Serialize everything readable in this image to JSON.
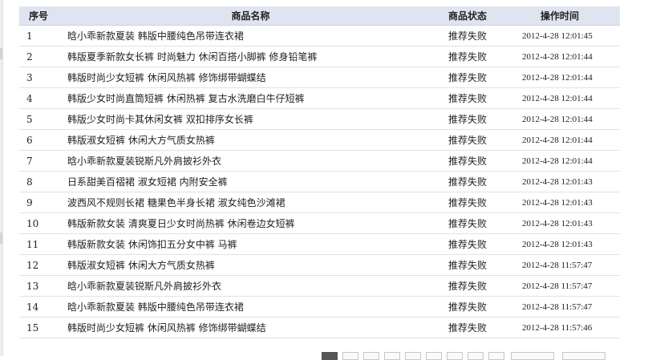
{
  "table": {
    "headers": {
      "index": "序号",
      "name": "商品名称",
      "status": "商品状态",
      "time": "操作时间"
    },
    "rows": [
      {
        "index": "1",
        "name": "晗小乖新款夏装 韩版中腰纯色吊带连衣裙",
        "status": "推荐失败",
        "time": "2012-4-28 12:01:45"
      },
      {
        "index": "2",
        "name": "韩版夏季新款女长裤 时尚魅力 休闲百搭小脚裤 修身铅笔裤",
        "status": "推荐失败",
        "time": "2012-4-28 12:01:44"
      },
      {
        "index": "3",
        "name": "韩版时尚少女短裤 休闲风热裤 修饰绑带蝴蝶结",
        "status": "推荐失败",
        "time": "2012-4-28 12:01:44"
      },
      {
        "index": "4",
        "name": "韩版少女时尚直筒短裤 休闲热裤 复古水洗磨白牛仔短裤",
        "status": "推荐失败",
        "time": "2012-4-28 12:01:44"
      },
      {
        "index": "5",
        "name": "韩版少女时尚卡其休闲女裤 双扣排序女长裤",
        "status": "推荐失败",
        "time": "2012-4-28 12:01:44"
      },
      {
        "index": "6",
        "name": "韩版淑女短裤 休闲大方气质女热裤",
        "status": "推荐失败",
        "time": "2012-4-28 12:01:44"
      },
      {
        "index": "7",
        "name": "晗小乖新款夏装锐斯凡外肩披衫外衣",
        "status": "推荐失败",
        "time": "2012-4-28 12:01:44"
      },
      {
        "index": "8",
        "name": "日系甜美百褶裙 淑女短裙 内附安全裤",
        "status": "推荐失败",
        "time": "2012-4-28 12:01:43"
      },
      {
        "index": "9",
        "name": "波西风不规则长裙 糖果色半身长裙 淑女纯色沙滩裙",
        "status": "推荐失败",
        "time": "2012-4-28 12:01:43"
      },
      {
        "index": "10",
        "name": "韩版新款女装 清爽夏日少女时尚热裤 休闲卷边女短裤",
        "status": "推荐失败",
        "time": "2012-4-28 12:01:43"
      },
      {
        "index": "11",
        "name": "韩版新款女装 休闲饰扣五分女中裤 马裤",
        "status": "推荐失败",
        "time": "2012-4-28 12:01:43"
      },
      {
        "index": "12",
        "name": "韩版淑女短裤 休闲大方气质女热裤",
        "status": "推荐失败",
        "time": "2012-4-28 11:57:47"
      },
      {
        "index": "13",
        "name": "晗小乖新款夏装锐斯凡外肩披衫外衣",
        "status": "推荐失败",
        "time": "2012-4-28 11:57:47"
      },
      {
        "index": "14",
        "name": "晗小乖新款夏装 韩版中腰纯色吊带连衣裙",
        "status": "推荐失败",
        "time": "2012-4-28 11:57:47"
      },
      {
        "index": "15",
        "name": "韩版时尚少女短裤 休闲风热裤 修饰绑带蝴蝶结",
        "status": "推荐失败",
        "time": "2012-4-28 11:57:46"
      }
    ]
  },
  "colors": {
    "header_bg": "#e0e4f0",
    "row_border": "#e2e2e2",
    "pager_current": "#555555"
  }
}
